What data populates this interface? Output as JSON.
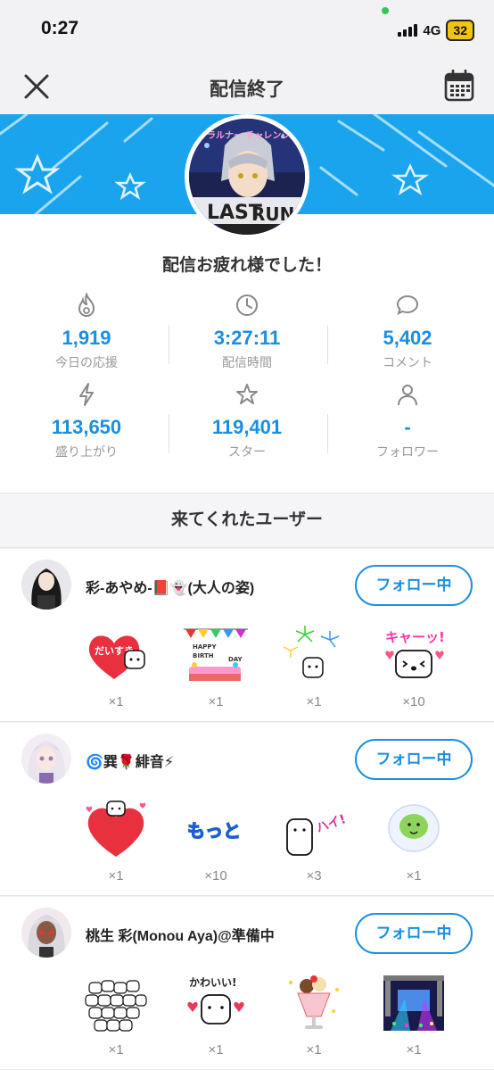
{
  "status": {
    "time": "0:27",
    "network": "4G",
    "battery": "32"
  },
  "nav": {
    "title": "配信終了"
  },
  "greeting": "配信お疲れ様でした！",
  "stats": [
    {
      "icon": "flame-icon",
      "value": "1,919",
      "label": "今日の応援"
    },
    {
      "icon": "clock-icon",
      "value": "3:27:11",
      "label": "配信時間"
    },
    {
      "icon": "comment-icon",
      "value": "5,402",
      "label": "コメント"
    },
    {
      "icon": "lightning-icon",
      "value": "113,650",
      "label": "盛り上がり"
    },
    {
      "icon": "star-icon",
      "value": "119,401",
      "label": "スター"
    },
    {
      "icon": "person-icon",
      "value": "-",
      "label": "フォロワー"
    }
  ],
  "section_title": "来てくれたユーザー",
  "users": [
    {
      "name": "彩-あやめ-📕👻(大人の姿)",
      "follow_label": "フォロー中",
      "gifts": [
        {
          "icon": "daisuki-heart-icon",
          "count": "×1"
        },
        {
          "icon": "happy-birthday-icon",
          "count": "×1"
        },
        {
          "icon": "fireworks-icon",
          "count": "×1"
        },
        {
          "icon": "kyaa-icon",
          "count": "×10"
        }
      ]
    },
    {
      "name": "🌀巽🌹緋音⚡",
      "follow_label": "フォロー中",
      "gifts": [
        {
          "icon": "big-heart-icon",
          "count": "×1"
        },
        {
          "icon": "motto-icon",
          "count": "×10"
        },
        {
          "icon": "hai-icon",
          "count": "×3"
        },
        {
          "icon": "green-ghost-icon",
          "count": "×1"
        }
      ]
    },
    {
      "name": "桃生 彩(Monou Aya)@準備中",
      "follow_label": "フォロー中",
      "gifts": [
        {
          "icon": "crowd-icon",
          "count": "×1"
        },
        {
          "icon": "kawaii-icon",
          "count": "×1"
        },
        {
          "icon": "parfait-icon",
          "count": "×1"
        },
        {
          "icon": "stage-icon",
          "count": "×1"
        }
      ]
    }
  ],
  "banner_texts": {
    "top": "ウラルナー チャレンジ中",
    "last": "LAST",
    "run": "RUN"
  },
  "gift_texts": {
    "daisuki": "だいすき",
    "happy": "HAPPY",
    "birth": "BIRTH",
    "day": "DAY",
    "kyaa": "キャーッ!",
    "motto": "もっと",
    "hai": "ハイ!",
    "kawaii": "かわいい!"
  }
}
